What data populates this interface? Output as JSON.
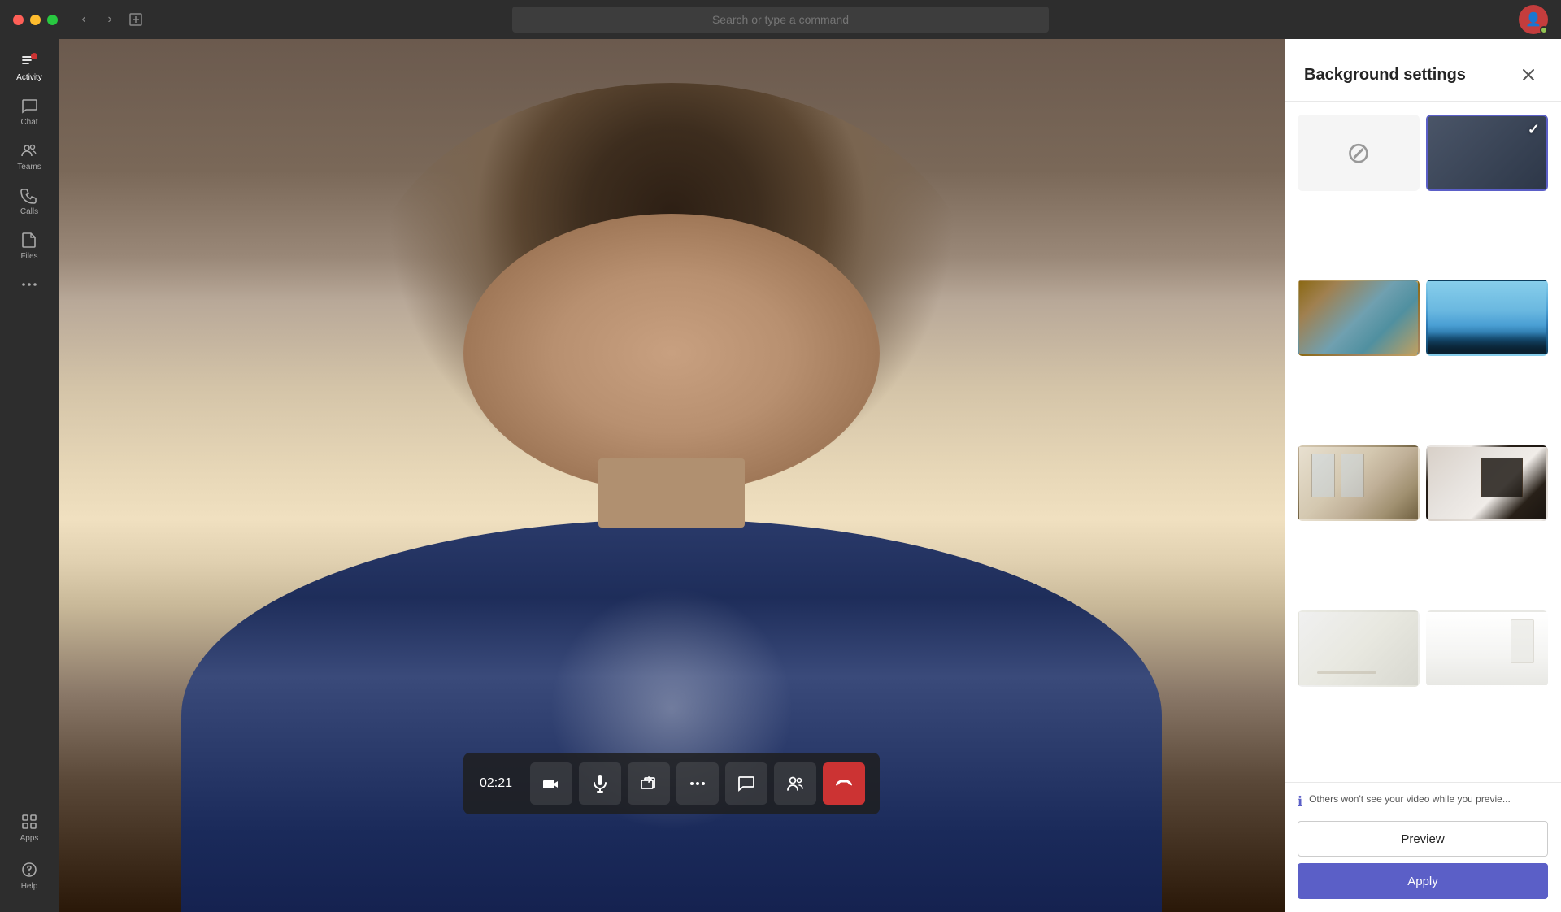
{
  "titlebar": {
    "search_placeholder": "Search or type a command",
    "avatar_initials": "👤"
  },
  "sidebar": {
    "items": [
      {
        "id": "activity",
        "label": "Activity",
        "active": true
      },
      {
        "id": "chat",
        "label": "Chat",
        "active": false
      },
      {
        "id": "teams",
        "label": "Teams",
        "active": false
      },
      {
        "id": "calls",
        "label": "Calls",
        "active": false
      },
      {
        "id": "files",
        "label": "Files",
        "active": false
      },
      {
        "id": "more",
        "label": "···",
        "active": false
      }
    ],
    "bottom_items": [
      {
        "id": "apps",
        "label": "Apps"
      },
      {
        "id": "help",
        "label": "Help"
      }
    ]
  },
  "call": {
    "timer": "02:21"
  },
  "bg_settings": {
    "title": "Background settings",
    "info_text": "Others won't see your video while you previe...",
    "preview_label": "Preview",
    "apply_label": "Apply",
    "backgrounds": [
      {
        "id": "none",
        "type": "none",
        "selected": false
      },
      {
        "id": "dark",
        "type": "dark",
        "selected": true
      },
      {
        "id": "office",
        "type": "office",
        "selected": false
      },
      {
        "id": "sky",
        "type": "sky",
        "selected": false
      },
      {
        "id": "room1",
        "type": "room1",
        "selected": false
      },
      {
        "id": "room2",
        "type": "room2",
        "selected": false
      },
      {
        "id": "white1",
        "type": "white1",
        "selected": false
      },
      {
        "id": "white2",
        "type": "white2",
        "selected": false
      }
    ]
  }
}
